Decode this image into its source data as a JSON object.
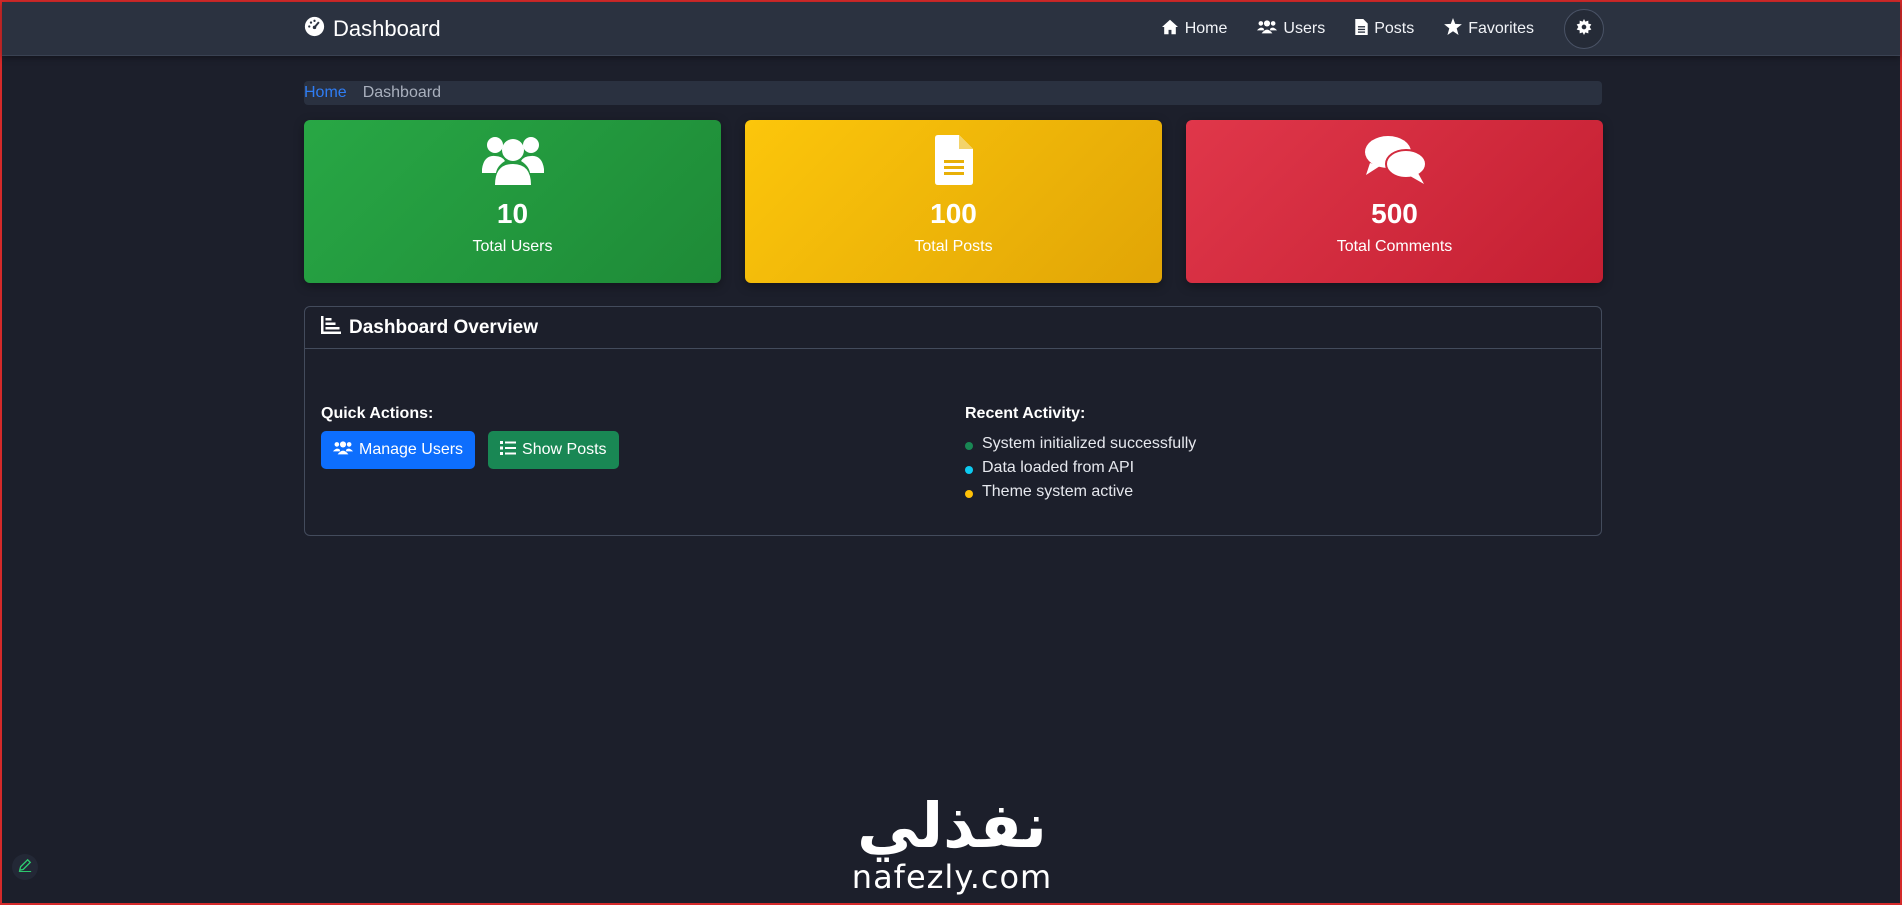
{
  "navbar": {
    "brand_icon": "gauge-icon",
    "brand_label": "Dashboard",
    "links": [
      {
        "label": "Home",
        "icon": "home-icon"
      },
      {
        "label": "Users",
        "icon": "users-icon"
      },
      {
        "label": "Posts",
        "icon": "file-icon"
      },
      {
        "label": "Favorites",
        "icon": "star-icon"
      }
    ],
    "theme_toggle_icon": "gear-icon"
  },
  "breadcrumb": {
    "home": "Home",
    "current": "Dashboard"
  },
  "stats": [
    {
      "value": "10",
      "label": "Total Users",
      "icon": "users-icon",
      "color": "#28a745"
    },
    {
      "value": "100",
      "label": "Total Posts",
      "icon": "file-icon",
      "color": "#fcc60b"
    },
    {
      "value": "500",
      "label": "Total Comments",
      "icon": "comments-icon",
      "color": "#e0374a"
    }
  ],
  "overview": {
    "title": "Dashboard Overview",
    "icon": "chart-bar-icon",
    "quick_actions": {
      "title": "Quick Actions:",
      "buttons": [
        {
          "label": "Manage Users",
          "icon": "users-icon",
          "color": "#0d6efd"
        },
        {
          "label": "Show Posts",
          "icon": "list-icon",
          "color": "#198754"
        }
      ]
    },
    "recent_activity": {
      "title": "Recent Activity:",
      "items": [
        {
          "text": "System initialized successfully",
          "dot_color": "#198754"
        },
        {
          "text": "Data loaded from API",
          "dot_color": "#0dcaf0"
        },
        {
          "text": "Theme system active",
          "dot_color": "#ffc107"
        }
      ]
    }
  },
  "watermark": {
    "arabic": "نفذلي",
    "latin": "nafezly.com"
  },
  "floating_button_icon": "pencil-icon"
}
